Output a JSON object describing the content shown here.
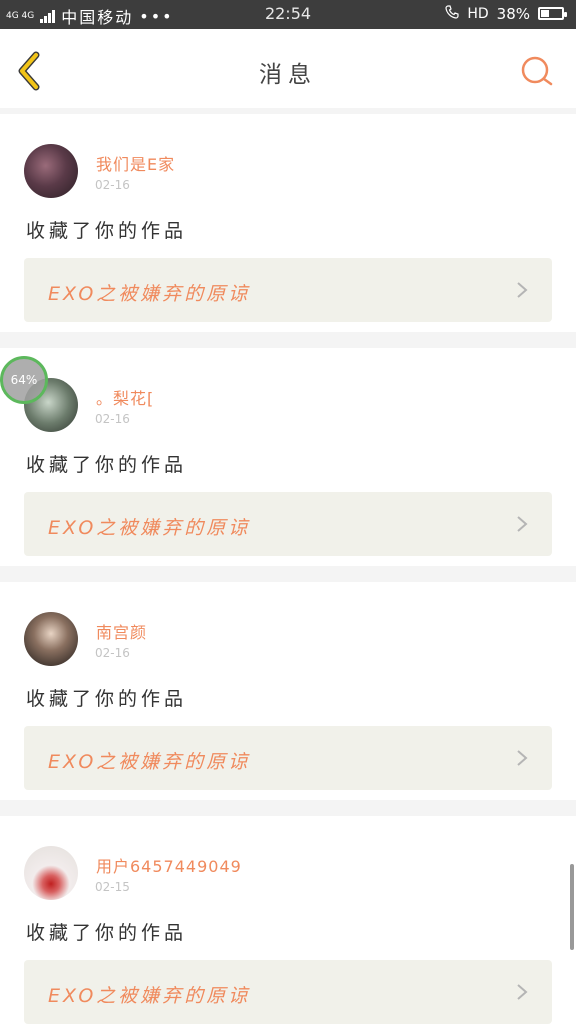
{
  "status_bar": {
    "network": "4G 4G",
    "carrier": "中国移动",
    "dots": "•••",
    "time": "22:54",
    "hd": "HD",
    "battery": "38%",
    "battery_level": 0.38
  },
  "header": {
    "title": "消息",
    "back_icon": "chevron-left-icon",
    "search_icon": "search-icon"
  },
  "floating_badge": {
    "text": "64%"
  },
  "messages": [
    {
      "username": "我们是E家",
      "date": "02-16",
      "action": "收藏了你的作品",
      "work_title": "EXO之被嫌弃的原谅"
    },
    {
      "username": "。梨花[",
      "date": "02-16",
      "action": "收藏了你的作品",
      "work_title": "EXO之被嫌弃的原谅"
    },
    {
      "username": "南宫颜",
      "date": "02-16",
      "action": "收藏了你的作品",
      "work_title": "EXO之被嫌弃的原谅"
    },
    {
      "username": "用户6457449049",
      "date": "02-15",
      "action": "收藏了你的作品",
      "work_title": "EXO之被嫌弃的原谅"
    }
  ],
  "colors": {
    "accent": "#f08a5d",
    "back_icon": "#f2c418",
    "status_bar": "#3d3d3d",
    "card_bg": "#f1f1ea"
  }
}
